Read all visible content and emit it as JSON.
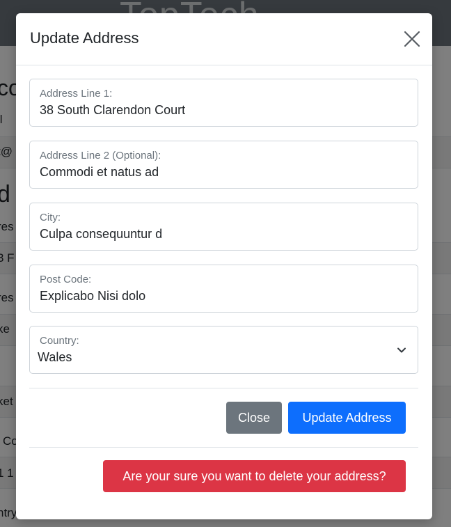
{
  "background": {
    "brand": "TopTech",
    "fragments": [
      "co",
      "il",
      "t@",
      "d",
      "res",
      "3 F",
      "res",
      "ke",
      "ket",
      "Co",
      "1 1",
      "ntry"
    ]
  },
  "modal": {
    "title": "Update Address",
    "fields": [
      {
        "label": "Address Line 1:",
        "value": "38 South Clarendon Court"
      },
      {
        "label": "Address Line 2 (Optional):",
        "value": "Commodi et natus ad"
      },
      {
        "label": "City:",
        "value": "Culpa consequuntur d"
      },
      {
        "label": "Post Code:",
        "value": "Explicabo Nisi dolo"
      }
    ],
    "country": {
      "label": "Country:",
      "selected": "Wales"
    },
    "buttons": {
      "close": "Close",
      "update": "Update Address",
      "delete": "Are your sure you want to delete your address?"
    }
  },
  "colors": {
    "primary": "#0d6efd",
    "secondary": "#6c757d",
    "danger": "#dc3545"
  },
  "icons": {
    "close": "close-icon",
    "chevron": "chevron-down-icon"
  }
}
